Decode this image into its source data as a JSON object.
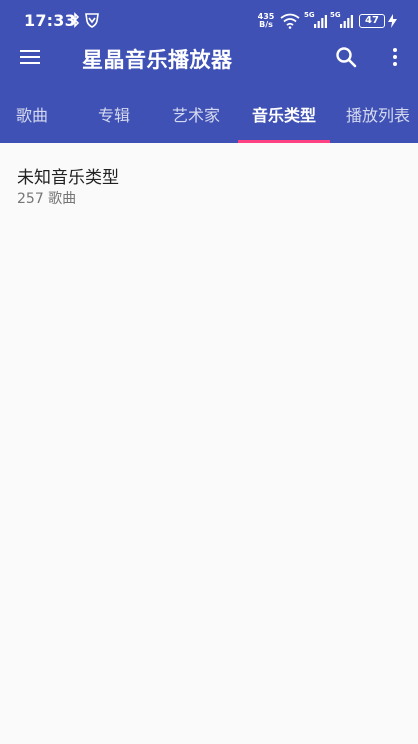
{
  "status_bar": {
    "time": "17:33",
    "net_speed_value": "435",
    "net_speed_unit": "B/s",
    "signal1_label": "5G",
    "signal2_label": "5G",
    "battery": "47"
  },
  "toolbar": {
    "title": "星晶音乐播放器",
    "menu_icon": "hamburger-menu-icon",
    "search_icon": "search-icon",
    "more_icon": "more-vertical-icon"
  },
  "tabs": [
    {
      "label": "歌曲"
    },
    {
      "label": "专辑"
    },
    {
      "label": "艺术家"
    },
    {
      "label": "音乐类型"
    },
    {
      "label": "播放列表"
    }
  ],
  "active_tab": "音乐类型",
  "colors": {
    "primary": "#3f51b5",
    "accent": "#ff4081",
    "background": "#fafafa"
  },
  "genres": [
    {
      "name": "未知音乐类型",
      "count": "257 歌曲"
    }
  ]
}
